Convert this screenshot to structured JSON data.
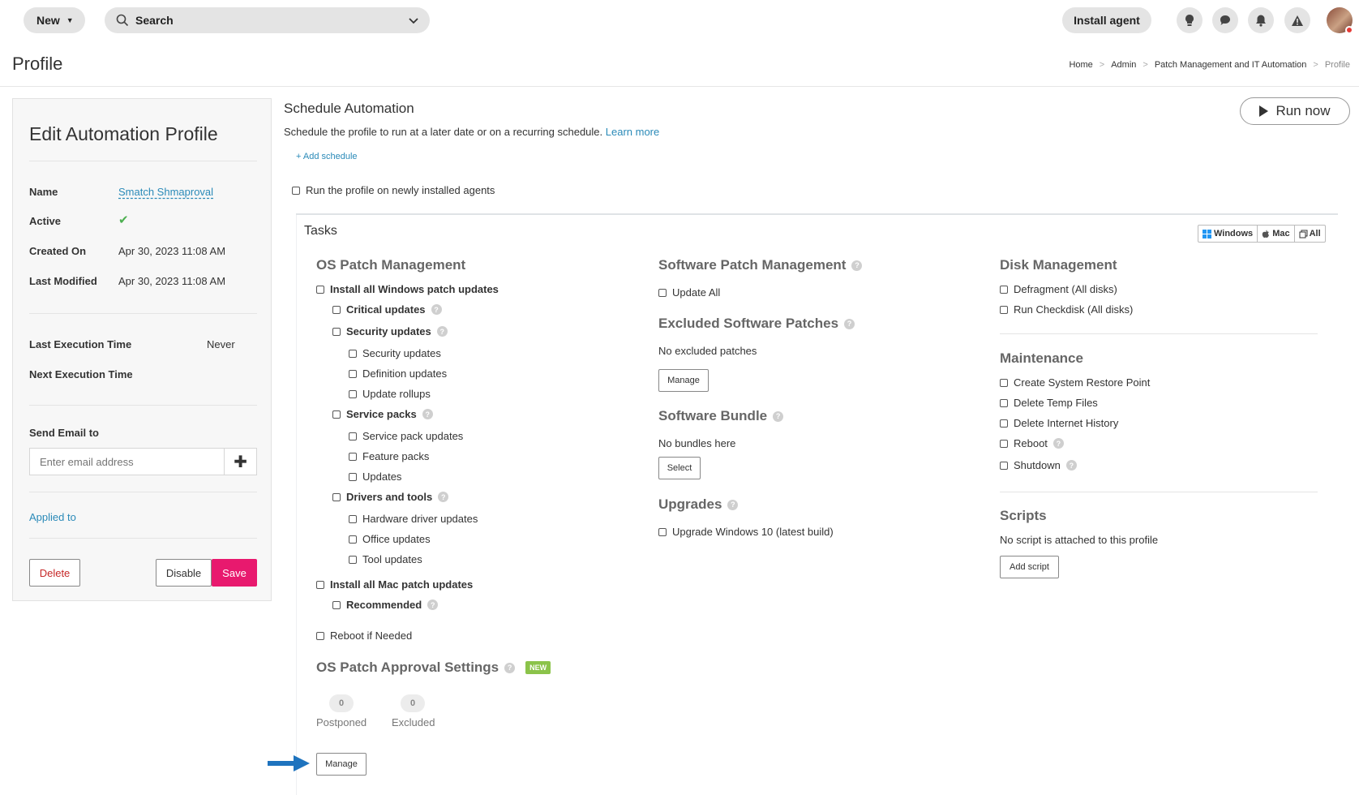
{
  "topbar": {
    "new_label": "New",
    "search_label": "Search",
    "install_agent_label": "Install agent"
  },
  "page": {
    "title": "Profile",
    "breadcrumb": [
      "Home",
      "Admin",
      "Patch Management and IT Automation",
      "Profile"
    ]
  },
  "left_panel": {
    "title": "Edit Automation Profile",
    "name_label": "Name",
    "name_value": "Smatch Shmaproval",
    "active_label": "Active",
    "created_label": "Created On",
    "created_value": "Apr 30, 2023 11:08 AM",
    "modified_label": "Last Modified",
    "modified_value": "Apr 30, 2023 11:08 AM",
    "last_exec_label": "Last Execution Time",
    "last_exec_value": "Never",
    "next_exec_label": "Next Execution Time",
    "send_email_label": "Send Email to",
    "email_placeholder": "Enter email address",
    "applied_to_label": "Applied to",
    "delete_label": "Delete",
    "disable_label": "Disable",
    "save_label": "Save"
  },
  "schedule": {
    "title": "Schedule Automation",
    "description": "Schedule the profile to run at a later date or on a recurring schedule.",
    "learn_more": "Learn more",
    "add_schedule": "Add schedule",
    "run_new_agents": "Run the profile on newly installed agents",
    "run_now": "Run now"
  },
  "tasks": {
    "title": "Tasks",
    "filter": [
      "Windows",
      "Mac",
      "All"
    ],
    "os_patch": {
      "title": "OS Patch Management",
      "install_windows": "Install all Windows patch updates",
      "critical": "Critical updates",
      "security": "Security updates",
      "security_sub": [
        "Security updates",
        "Definition updates",
        "Update rollups"
      ],
      "service_packs": "Service packs",
      "service_sub": [
        "Service pack updates",
        "Feature packs",
        "Updates"
      ],
      "drivers": "Drivers and tools",
      "drivers_sub": [
        "Hardware driver updates",
        "Office updates",
        "Tool updates"
      ],
      "install_mac": "Install all Mac patch updates",
      "recommended": "Recommended",
      "reboot_if_needed": "Reboot if Needed"
    },
    "approval": {
      "title": "OS Patch Approval Settings",
      "badge": "NEW",
      "postponed_count": "0",
      "postponed_label": "Postponed",
      "excluded_count": "0",
      "excluded_label": "Excluded",
      "manage_label": "Manage"
    },
    "software_patch": {
      "title": "Software Patch Management",
      "update_all": "Update All"
    },
    "excluded": {
      "title": "Excluded Software Patches",
      "empty": "No excluded patches",
      "manage_label": "Manage"
    },
    "bundle": {
      "title": "Software Bundle",
      "empty": "No bundles here",
      "select_label": "Select"
    },
    "upgrades": {
      "title": "Upgrades",
      "item": "Upgrade Windows 10 (latest build)"
    },
    "disk": {
      "title": "Disk Management",
      "items": [
        "Defragment (All disks)",
        "Run Checkdisk (All disks)"
      ]
    },
    "maintenance": {
      "title": "Maintenance",
      "items": [
        "Create System Restore Point",
        "Delete Temp Files",
        "Delete Internet History",
        "Reboot",
        "Shutdown"
      ]
    },
    "scripts": {
      "title": "Scripts",
      "empty": "No script is attached to this profile",
      "add_label": "Add script"
    }
  },
  "colors": {
    "accent_pink": "#e8196e",
    "link_blue": "#2a8ab8",
    "arrow_blue": "#1e73be",
    "active_green": "#4caf50",
    "new_badge_green": "#8bc34a"
  }
}
